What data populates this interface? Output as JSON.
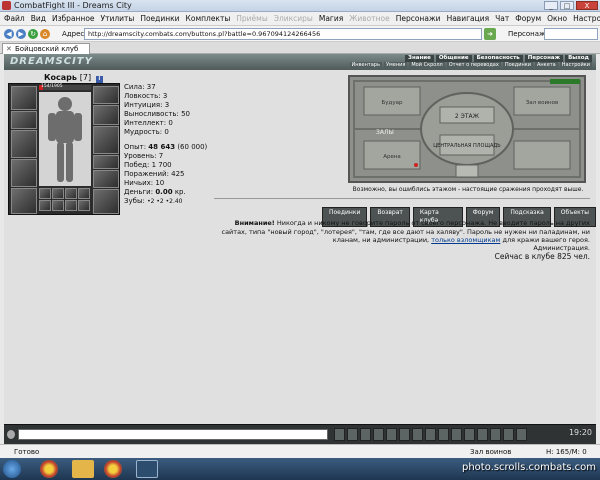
{
  "window": {
    "title": "CombatFight III - Dreams City",
    "minimize": "_",
    "maximize": "□",
    "close": "X"
  },
  "menu": [
    {
      "label": "Файл",
      "enabled": true
    },
    {
      "label": "Вид",
      "enabled": true
    },
    {
      "label": "Избранное",
      "enabled": true
    },
    {
      "label": "Утилиты",
      "enabled": true
    },
    {
      "label": "Поединки",
      "enabled": true
    },
    {
      "label": "Комплекты",
      "enabled": true
    },
    {
      "label": "Приёмы",
      "enabled": false
    },
    {
      "label": "Эликсиры",
      "enabled": false
    },
    {
      "label": "Магия",
      "enabled": true
    },
    {
      "label": "Животное",
      "enabled": false
    },
    {
      "label": "Персонажи",
      "enabled": true
    },
    {
      "label": "Навигация",
      "enabled": true
    },
    {
      "label": "Чат",
      "enabled": true
    },
    {
      "label": "Форум",
      "enabled": true
    },
    {
      "label": "Окно",
      "enabled": true
    },
    {
      "label": "Настройки",
      "enabled": true
    },
    {
      "label": "?",
      "enabled": true
    }
  ],
  "address": {
    "label": "Адрес",
    "url": "http://dreamscity.combats.com/buttons.pl?battle=0.967094124266456",
    "persona_label": "Персонаж"
  },
  "tab": {
    "label": "Бойцовский клуб"
  },
  "site": {
    "logo": "DREAMSCITY",
    "nav_top": [
      "Знание",
      "Общение",
      "Безопасность",
      "Персонаж",
      "Выход"
    ],
    "nav_bottom": [
      "Инвентарь",
      "Умения",
      "Мой Скролл",
      "Отчет о переводах",
      "Поединки",
      "Анкета",
      "Настройки"
    ]
  },
  "character": {
    "name": "Косарь",
    "level": "[7]",
    "info_icon": "i",
    "hp_text": "154/1905",
    "hp_fraction": 0.08,
    "stats": [
      "Сила: 37",
      "Ловкость: 3",
      "Интуиция: 3",
      "Выносливость: 50",
      "Интеллект: 0",
      "Мудрость: 0"
    ],
    "exp_label": "Опыт:",
    "exp_value": "48 643",
    "exp_next": "(60 000)",
    "level_line": "Уровень: 7",
    "wins": "Побед: 1 700",
    "losses": "Поражений: 425",
    "draws": "Ничьих: 10",
    "money_label": "Деньги:",
    "money_value": "0.00",
    "money_unit": "кр.",
    "teeth_label": "Зубы:",
    "teeth_value": "•2 •2 •2.40"
  },
  "map": {
    "floor": "2 ЭТАЖ",
    "left_wing": "ЗАЛЫ",
    "hall": "ЦЕНТРАЛЬНАЯ ПЛОЩАДЬ",
    "room_top_left": "Будуар",
    "room_top_right": "Зал воинов",
    "room_bottom_left": "Арена",
    "caption": "Возможно, вы ошиблись этажом - настоящие сражения проходят выше."
  },
  "buttons": [
    "Поединки",
    "Возврат",
    "Карта клуба",
    "Форум",
    "Подсказка",
    "Объекты"
  ],
  "warning": {
    "bold": "Внимание!",
    "text1": " Никогда и никому не говорите пароль от своего персонажа. Не вводите пароль на других сайтах, типа \"новый город\", \"лотерея\", \"там, где все дают на халяву\". Пароль не нужен ни паладинам, ни кланам, ни администрации, ",
    "link": "только взломщикам",
    "text2": " для кражи вашего героя.",
    "admin": "Администрация.",
    "online": "Сейчас в клубе 825 чел."
  },
  "chat": {
    "time": "19:20"
  },
  "status": {
    "left": "Готово",
    "room": "Зал воинов",
    "hm": "Н: 165/М: 0"
  },
  "taskbar": {
    "watermark": "photo.scrolls.combats.com"
  },
  "colors": {
    "hp": "#cc2222",
    "header": "#5b6666",
    "link": "#003b8f"
  }
}
